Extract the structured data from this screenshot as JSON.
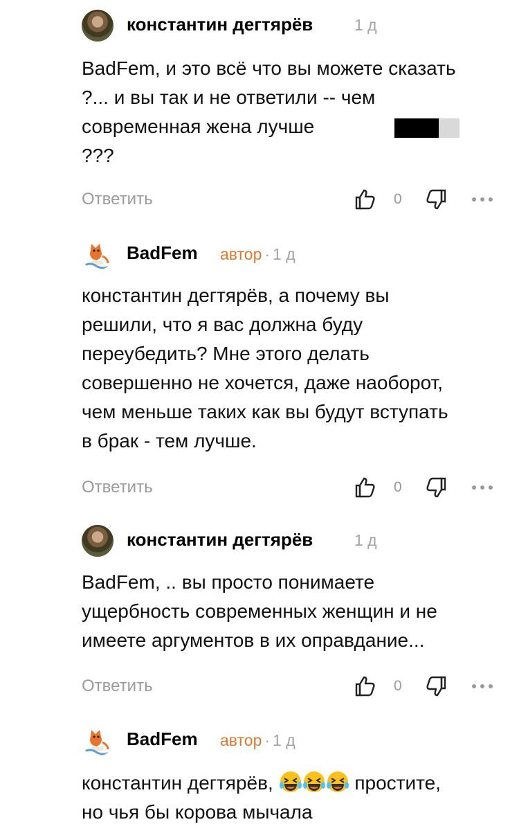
{
  "comments": [
    {
      "author": "константин дегтярёв",
      "is_author": false,
      "author_tag": "",
      "time": "1 д",
      "lines": [
        "BadFem, и это всё что вы можете сказать",
        "?... и вы так и не ответили -- чем",
        "современная жена лучше",
        "???"
      ],
      "reply": "Ответить",
      "likes": "0"
    },
    {
      "author": "BadFem",
      "is_author": true,
      "author_tag": "автор",
      "time": "1 д",
      "lines": [
        "константин дегтярёв, а почему вы",
        "решили, что я вас должна буду",
        "переубедить? Мне этого делать",
        "совершенно не хочется, даже наоборот,",
        "чем меньше таких как вы будут вступать",
        "в брак - тем лучше."
      ],
      "reply": "Ответить",
      "likes": "0"
    },
    {
      "author": "константин дегтярёв",
      "is_author": false,
      "author_tag": "",
      "time": "1 д",
      "lines": [
        "BadFem, .. вы просто понимаете",
        "ущербность современных женщин и не",
        "имеете аргументов в их оправдание..."
      ],
      "reply": "Ответить",
      "likes": "0"
    },
    {
      "author": "BadFem",
      "is_author": true,
      "author_tag": "автор",
      "time": "1 д",
      "lines": [
        "константин дегтярёв,",
        "простите,",
        "но чья бы корова мычала"
      ],
      "reply": "",
      "likes": ""
    }
  ],
  "icons": {
    "like": "thumb-up-icon",
    "dislike": "thumb-down-icon",
    "more": "more-dots-icon",
    "emoji": "laughing-with-tears-emoji"
  },
  "colors": {
    "author_tag": "#e0772e",
    "muted": "#9a9a9a",
    "text": "#111111"
  }
}
